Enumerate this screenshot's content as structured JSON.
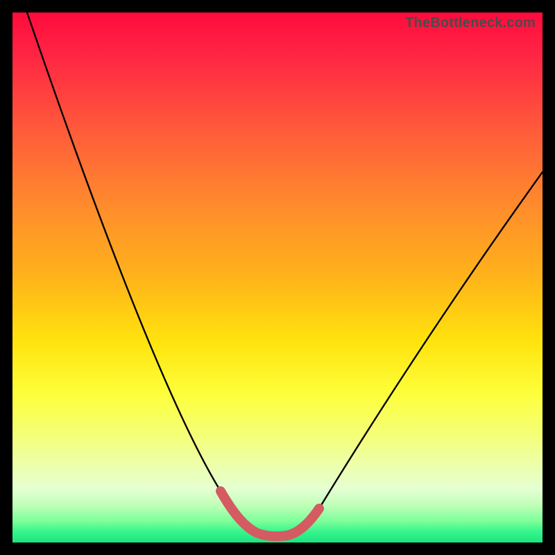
{
  "watermark": "TheBottleneck.com",
  "colors": {
    "black_frame": "#000000",
    "curve_stroke": "#000000",
    "highlight_stroke": "#d45b62"
  },
  "chart_data": {
    "type": "line",
    "title": "",
    "xlabel": "",
    "ylabel": "",
    "xlim": [
      0,
      100
    ],
    "ylim": [
      0,
      100
    ],
    "grid": false,
    "legend": false,
    "series": [
      {
        "name": "bottleneck-curve",
        "x": [
          2,
          6,
          10,
          14,
          18,
          22,
          26,
          30,
          34,
          37,
          40,
          43,
          45,
          47,
          49,
          52,
          55,
          60,
          65,
          70,
          75,
          80,
          85,
          90,
          95,
          100
        ],
        "y": [
          100,
          91,
          82,
          73,
          65,
          57,
          49,
          41,
          33,
          25,
          17,
          10,
          5,
          2,
          1,
          1,
          2,
          7,
          14,
          22,
          30,
          38,
          46,
          54,
          62,
          70
        ]
      }
    ],
    "annotations": [
      {
        "name": "ideal-zone-highlight",
        "x_range": [
          40,
          56
        ],
        "note": "bottom of curve highlighted in pink"
      }
    ]
  }
}
